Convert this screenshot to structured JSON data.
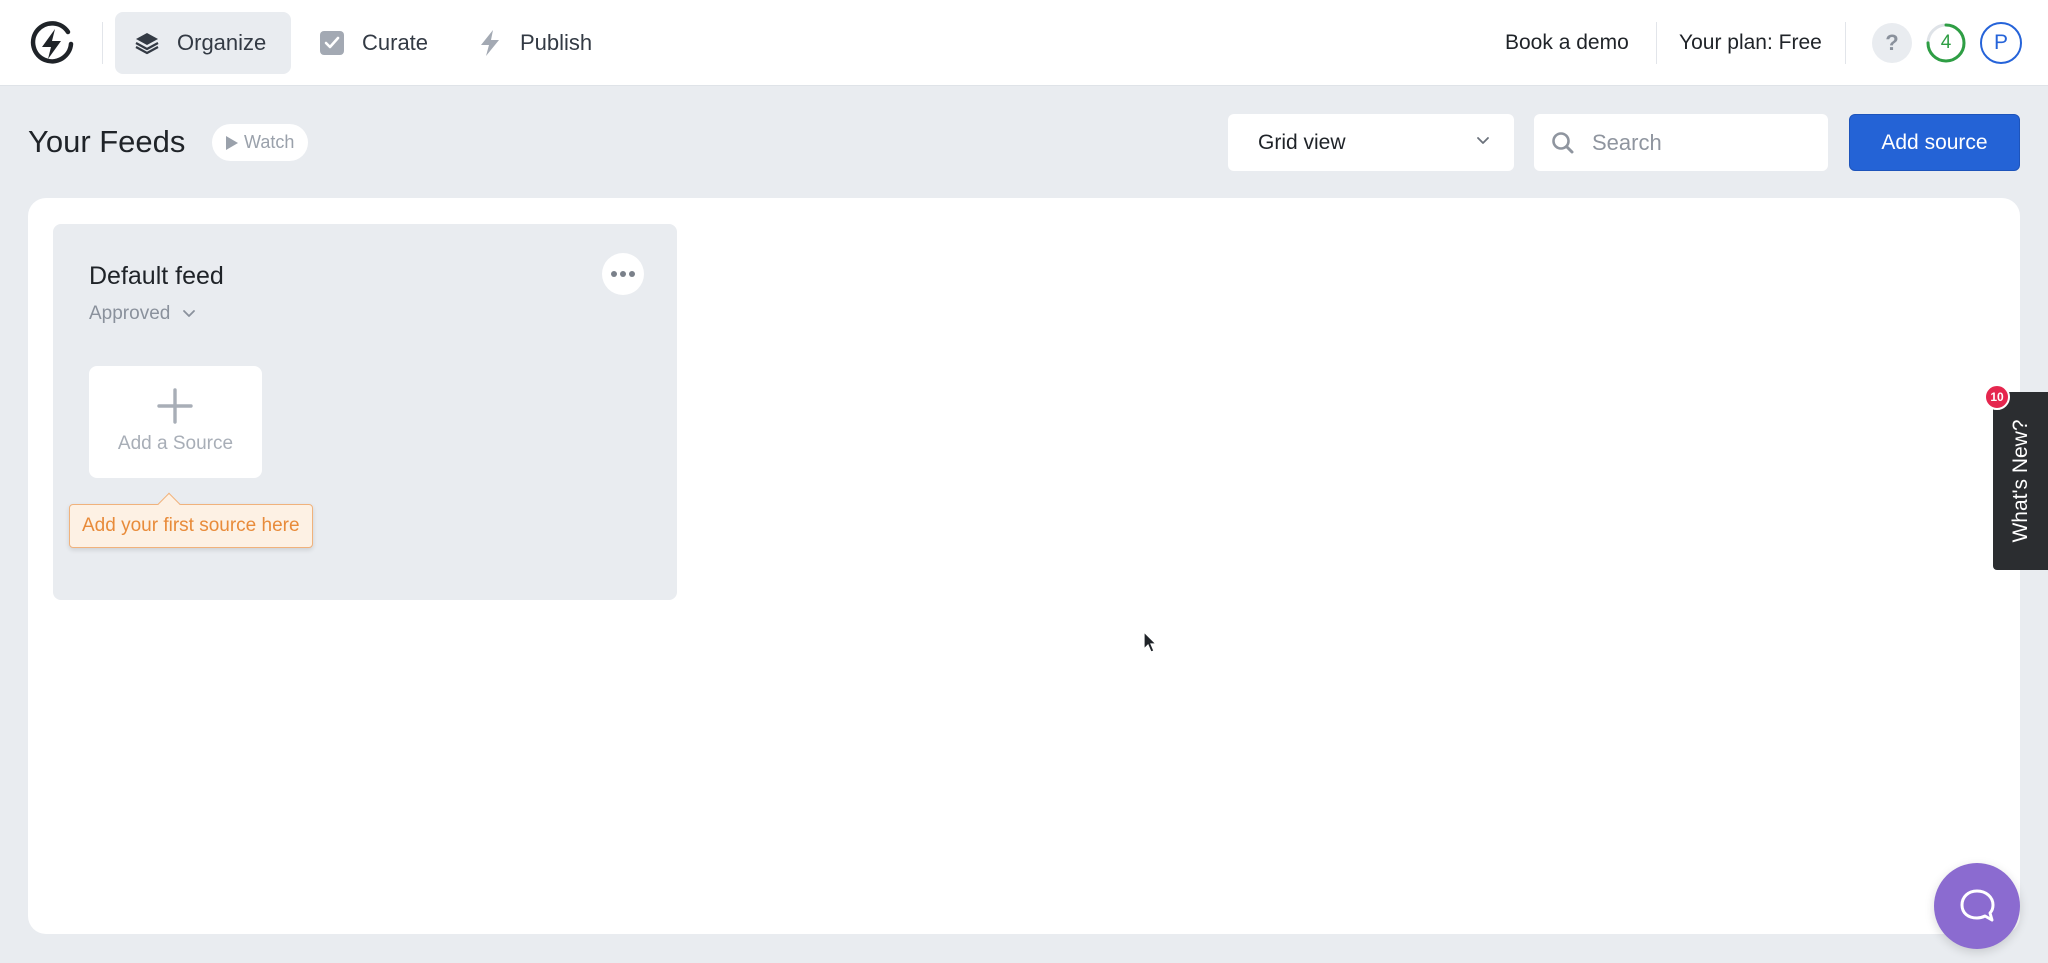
{
  "nav": {
    "items": [
      {
        "label": "Organize",
        "icon": "layers-icon",
        "active": true
      },
      {
        "label": "Curate",
        "icon": "checkbox-icon",
        "active": false
      },
      {
        "label": "Publish",
        "icon": "lightning-icon",
        "active": false
      }
    ],
    "book_demo": "Book a demo",
    "plan": "Your plan: Free",
    "help": "?",
    "progress_count": "4",
    "progress_fraction": 0.75,
    "avatar_initial": "P"
  },
  "header": {
    "title": "Your Feeds",
    "watch_label": "Watch",
    "view_select": "Grid view",
    "search_placeholder": "Search",
    "add_source_label": "Add source"
  },
  "feeds": [
    {
      "title": "Default feed",
      "status": "Approved",
      "add_tile_label": "Add a Source",
      "tooltip": "Add your first source here"
    }
  ],
  "whats_new": {
    "label": "What's New?",
    "badge": "10"
  },
  "colors": {
    "accent": "#2463d6",
    "progress": "#2e9e44",
    "tooltip_text": "#e88b3a",
    "badge": "#e5264e",
    "chat": "#8b6bd0"
  }
}
